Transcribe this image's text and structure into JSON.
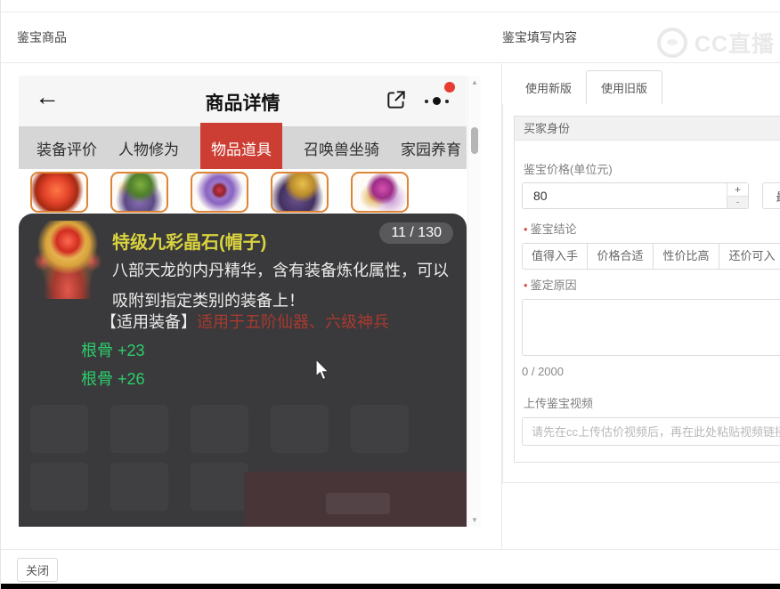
{
  "page": {
    "left_header": "鉴宝商品",
    "right_header": "鉴宝填写内容",
    "watermark": "CC直播",
    "close_button": "关闭"
  },
  "phone": {
    "title": "商品详情",
    "counter_badge": "11 / 130",
    "tabs": [
      {
        "label": "装备评价",
        "selected": false
      },
      {
        "label": "人物修为",
        "selected": false
      },
      {
        "label": "物品道具",
        "selected": true
      },
      {
        "label": "召唤兽坐骑",
        "selected": false
      },
      {
        "label": "家园养育",
        "selected": false
      }
    ],
    "tooltip": {
      "title": "特级九彩晶石(帽子)",
      "desc_line1": "八部天龙的内丹精华，含有装备炼化属性，可以",
      "desc_line2": "吸附到指定类别的装备上！",
      "apply_label": "【适用装备】",
      "apply_value": "适用于五阶仙器、六级神兵",
      "attrs": [
        "根骨 +23",
        "根骨 +26"
      ]
    }
  },
  "form": {
    "tabs": [
      {
        "label": "使用新版",
        "selected": false
      },
      {
        "label": "使用旧版",
        "selected": true
      }
    ],
    "buyer_identity_label": "买家身份",
    "price_label": "鉴宝价格(单位元)",
    "price_value": "80",
    "max_button_label": "最",
    "conclusion_label": "鉴宝结论",
    "conclusion_options": [
      "值得入手",
      "价格合适",
      "性价比高",
      "还价可入"
    ],
    "reason_label": "鉴定原因",
    "char_counter": "0 / 2000",
    "video_label": "上传鉴宝视频",
    "video_placeholder": "请先在cc上传估价视频后，再在此处粘贴视频链接"
  },
  "icons": {
    "back_arrow": "←",
    "scroll_up": "▲",
    "scroll_down": "▼",
    "stepper_plus": "+",
    "stepper_minus": "-",
    "required_marker": "•"
  },
  "colors": {
    "accent_red": "#cc3e33",
    "tooltip_title_yellow": "#d9d43e",
    "attr_green": "#2bcf6c",
    "apply_red": "#a93a30",
    "notification_red": "#e63d30"
  }
}
